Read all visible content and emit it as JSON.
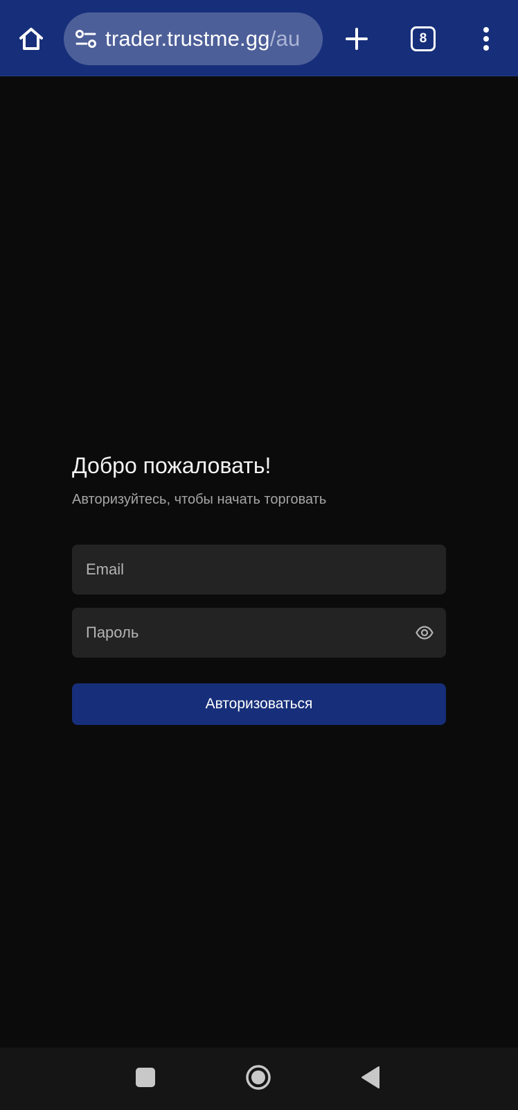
{
  "browser": {
    "url_host": "trader.trustme.gg",
    "url_path": "/au",
    "tab_count": "8",
    "icons": {
      "home": "home-icon",
      "site_info": "site-settings-icon",
      "new_tab": "plus-icon",
      "menu": "more-vert-icon"
    },
    "toolbar_color": "#172f7a"
  },
  "login": {
    "title": "Добро пожаловать!",
    "subtitle": "Авторизуйтесь, чтобы начать торговать",
    "email": {
      "placeholder": "Email",
      "value": ""
    },
    "password": {
      "placeholder": "Пароль",
      "value": "",
      "toggle_icon": "eye-icon"
    },
    "submit_label": "Авторизоваться",
    "button_color": "#172f7a",
    "field_color": "#232323"
  },
  "nav_bar": {
    "icons": {
      "recents": "square-icon",
      "home": "circle-icon",
      "back": "triangle-back-icon"
    }
  }
}
